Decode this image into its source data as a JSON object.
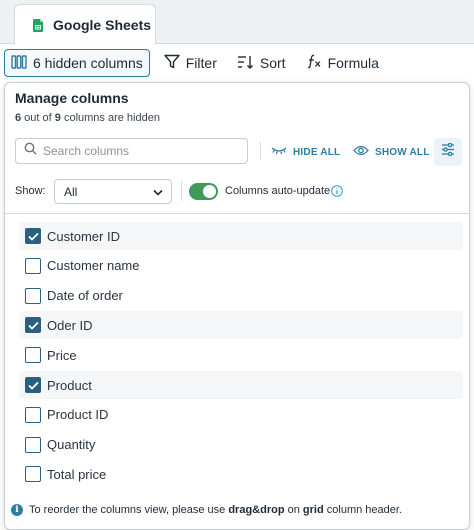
{
  "tab": {
    "label": "Google Sheets",
    "icon": "google-sheets-icon"
  },
  "toolbar": {
    "hidden_columns_label": "6 hidden columns",
    "filter_label": "Filter",
    "sort_label": "Sort",
    "formula_label": "Formula"
  },
  "panel": {
    "title": "Manage columns",
    "hidden_count": "6",
    "sub_mid": " out of ",
    "total_count": "9",
    "sub_end": " columns are hidden",
    "search_placeholder": "Search columns",
    "hide_all": "HIDE ALL",
    "show_all": "SHOW ALL",
    "show_label": "Show:",
    "show_value": "All",
    "auto_update_label": "Columns auto-update",
    "auto_update_on": true
  },
  "columns": [
    {
      "label": "Customer ID",
      "checked": true
    },
    {
      "label": "Customer name",
      "checked": false
    },
    {
      "label": "Date of order",
      "checked": false
    },
    {
      "label": "Oder ID",
      "checked": true
    },
    {
      "label": "Price",
      "checked": false
    },
    {
      "label": "Product",
      "checked": true
    },
    {
      "label": "Product ID",
      "checked": false
    },
    {
      "label": "Quantity",
      "checked": false
    },
    {
      "label": "Total price",
      "checked": false
    }
  ],
  "footer": {
    "pre": "To reorder the columns view, please use ",
    "b1": "drag&drop",
    "mid": " on ",
    "b2": "grid",
    "post": " column header."
  },
  "colors": {
    "accent": "#2f7da1",
    "checkbox": "#2a5f7f",
    "toggle_on": "#3f9a5a",
    "sheets_green": "#1fa463"
  }
}
